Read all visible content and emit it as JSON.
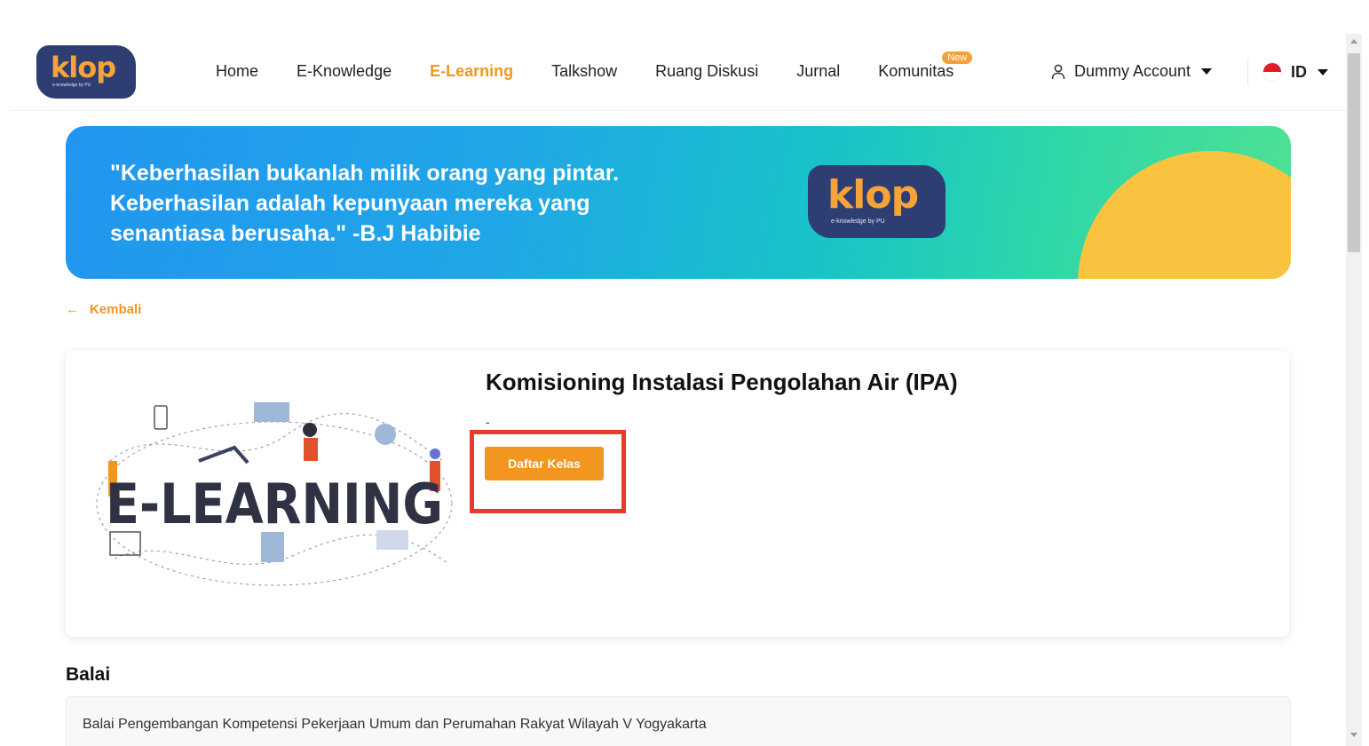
{
  "header": {
    "logo_text": "klop",
    "logo_sub": "e-knowledge by PU",
    "nav": [
      {
        "label": "Home",
        "active": false
      },
      {
        "label": "E-Knowledge",
        "active": false
      },
      {
        "label": "E-Learning",
        "active": true
      },
      {
        "label": "Talkshow",
        "active": false
      },
      {
        "label": "Ruang Diskusi",
        "active": false
      },
      {
        "label": "Jurnal",
        "active": false
      },
      {
        "label": "Komunitas",
        "active": false,
        "badge": "New"
      }
    ],
    "account_name": "Dummy Account",
    "language": "ID"
  },
  "banner": {
    "quote_line1": "\"Keberhasilan bukanlah milik orang yang pintar.",
    "quote_line2": "Keberhasilan adalah kepunyaan mereka yang",
    "quote_line3": "senantiasa berusaha.\" -B.J Habibie",
    "logo_text": "klop",
    "logo_sub": "e-knowledge by PU"
  },
  "back_label": "Kembali",
  "course": {
    "title": "Komisioning Instalasi Pengolahan Air (IPA)",
    "subtitle": "-",
    "illustration_text": "E-LEARNING",
    "enroll_label": "Daftar Kelas"
  },
  "balai": {
    "heading": "Balai",
    "value": "Balai Pengembangan Kompetensi Pekerjaan Umum dan Perumahan Rakyat Wilayah V Yogyakarta"
  },
  "colors": {
    "accent": "#f2961f",
    "brand_navy": "#2f3e72",
    "highlight": "#e53a2d"
  }
}
